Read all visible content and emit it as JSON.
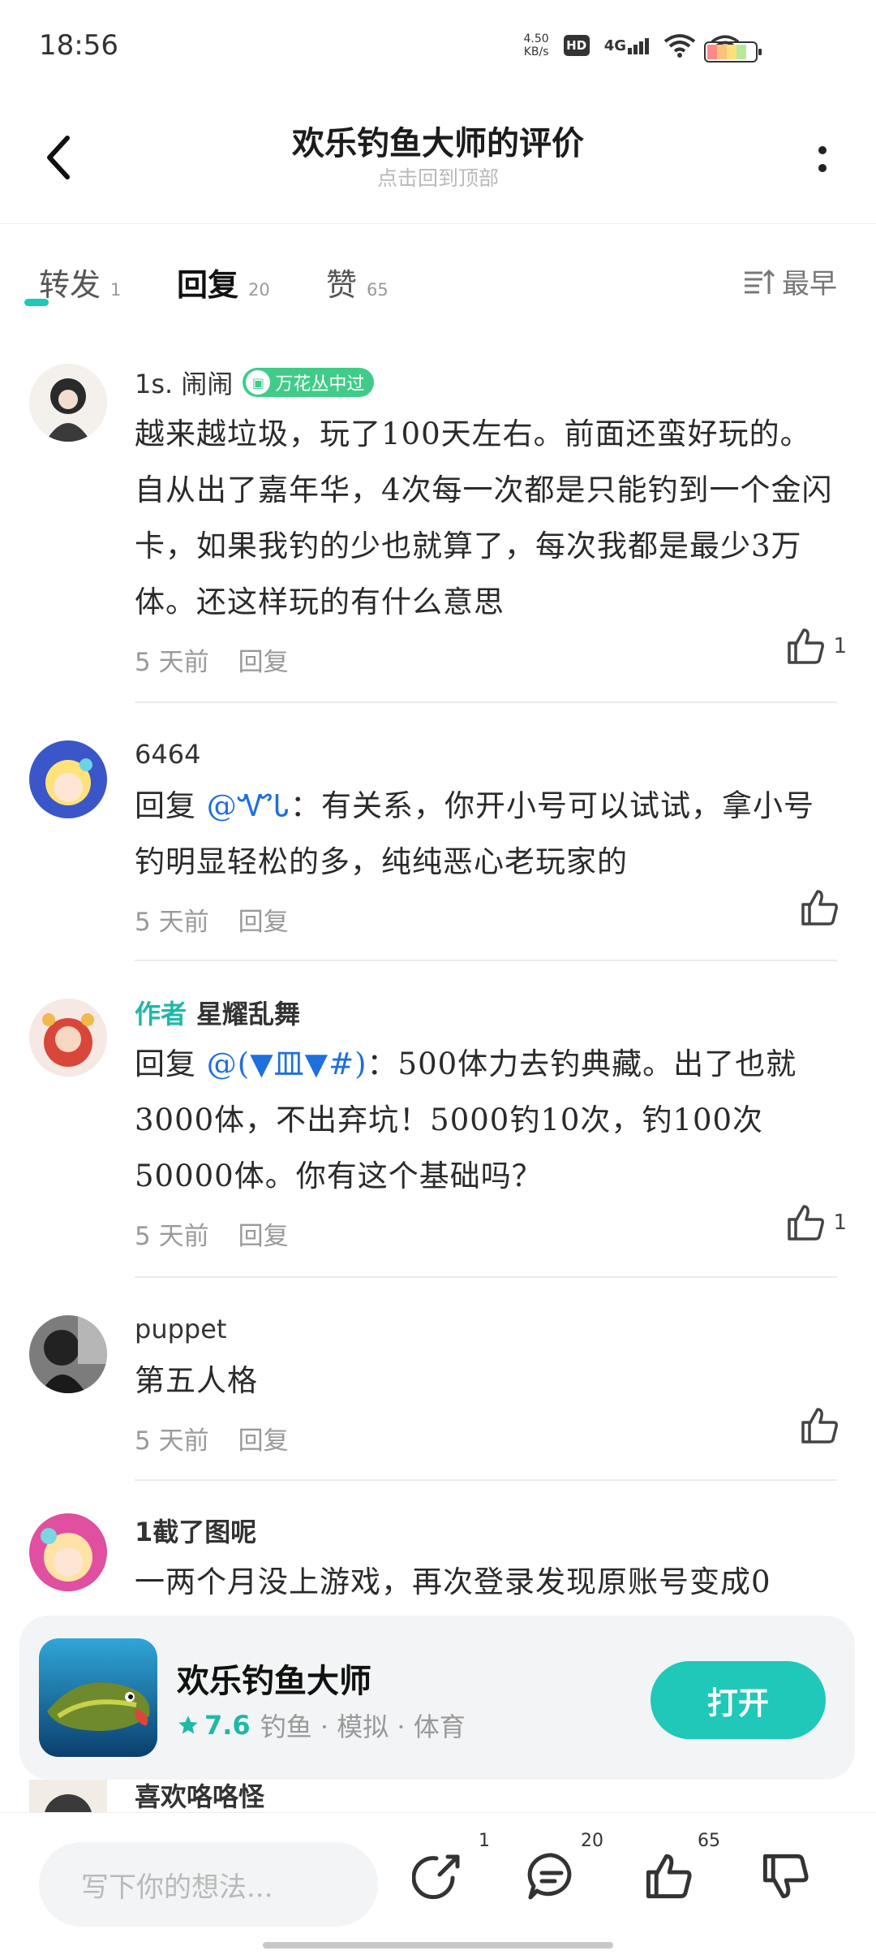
{
  "status_bar": {
    "time": "18:56",
    "net_speed_value": "4.50",
    "net_speed_unit": "KB/s",
    "hd": "HD",
    "network": "4G"
  },
  "header": {
    "title": "欢乐钓鱼大师的评价",
    "subtitle": "点击回到顶部"
  },
  "tabs": [
    {
      "label": "转发",
      "count": "1"
    },
    {
      "label": "回复",
      "count": "20"
    },
    {
      "label": "赞",
      "count": "65"
    }
  ],
  "sort": {
    "label": "最早"
  },
  "comments": [
    {
      "name": "1s. 闹闹",
      "badge": "万花丛中过",
      "text": "越来越垃圾，玩了100天左右。前面还蛮好玩的。自从出了嘉年华，4次每一次都是只能钓到一个金闪卡，如果我钓的少也就算了，每次我都是最少3万体。还这样玩的有什么意思",
      "time": "5 天前",
      "reply": "回复",
      "likes": "1"
    },
    {
      "name": "6464",
      "reply_prefix": "回复",
      "mention": "@ᏉᏓ",
      "text": "：有关系，你开小号可以试试，拿小号钓明显轻松的多，纯纯恶心老玩家的",
      "time": "5 天前",
      "reply": "回复",
      "likes": ""
    },
    {
      "author_tag": "作者",
      "name": "星耀乱舞",
      "reply_prefix": "回复",
      "mention": "@(▼皿▼#)",
      "text": "：500体力去钓典藏。出了也就3000体，不出弃坑！5000钓10次，钓100次50000体。你有这个基础吗？",
      "time": "5 天前",
      "reply": "回复",
      "likes": "1"
    },
    {
      "name": "puppet",
      "text": "第五人格",
      "time": "5 天前",
      "reply": "回复",
      "likes": ""
    },
    {
      "name": "1截了图呢",
      "text": "一两个月没上游戏，再次登录发现原账号变成0"
    }
  ],
  "peek_comment": {
    "name": "喜欢咯咯怪"
  },
  "app_card": {
    "name": "欢乐钓鱼大师",
    "score": "7.6",
    "tags": "钓鱼 · 模拟 · 体育",
    "open_label": "打开"
  },
  "bottom_bar": {
    "input_placeholder": "写下你的想法...",
    "share_count": "1",
    "comment_count": "20",
    "like_count": "65"
  },
  "colors": {
    "accent": "#1fc8b8",
    "mention": "#1f6fdc",
    "badge": "#40cc88"
  }
}
